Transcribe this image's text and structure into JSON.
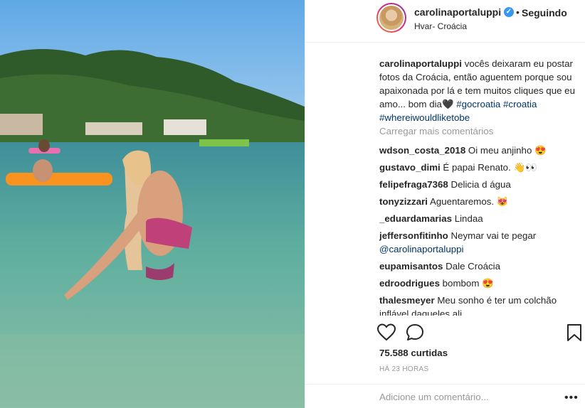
{
  "header": {
    "username": "carolinaportaluppi",
    "separator": "•",
    "follow_label": "Seguindo",
    "location": "Hvar- Croácia",
    "verified_icon": "verified-badge-icon"
  },
  "caption": {
    "username": "carolinaportaluppi",
    "text": " vocês deixaram eu postar fotos da Croácia, então aguentem porque sou apaixonada por lá e tem muitos cliques que eu amo... bom dia🖤",
    "hashtags": [
      "#gocroatia",
      "#croatia",
      "#whereiwouldliketobe"
    ]
  },
  "load_more_label": "Carregar mais comentários",
  "comments": [
    {
      "user": "wdson_costa_2018",
      "text": " Oi meu anjinho 😍"
    },
    {
      "user": "gustavo_dimi",
      "text": " É papai Renato. 👋👀"
    },
    {
      "user": "felipefraga7368",
      "text": " Delicia d água"
    },
    {
      "user": "tonyzizzari",
      "text": " Aguentaremos. 😻"
    },
    {
      "user": "_eduardamarias",
      "text": " Lindaa"
    },
    {
      "user": "jeffersonfitinho",
      "text": " Neymar vai te pegar",
      "mention": "@carolinaportaluppi"
    },
    {
      "user": "eupamisantos",
      "text": " Dale Croácia"
    },
    {
      "user": "edroodrigues",
      "text": " bombom 😍"
    },
    {
      "user": "thalesmeyer",
      "text": " Meu sonho é ter um colchão",
      "text2": "inflável daqueles ali"
    }
  ],
  "likes_label": "75.588 curtidas",
  "time_label": "HÁ 23 HORAS",
  "add_comment_placeholder": "Adicione um comentário...",
  "more_options_label": "•••",
  "icons": {
    "like": "heart-icon",
    "comment": "comment-icon",
    "save": "bookmark-icon"
  },
  "colors": {
    "accent_blue": "#3897f0",
    "hashtag": "#003569",
    "muted": "#999999",
    "text": "#262626"
  }
}
